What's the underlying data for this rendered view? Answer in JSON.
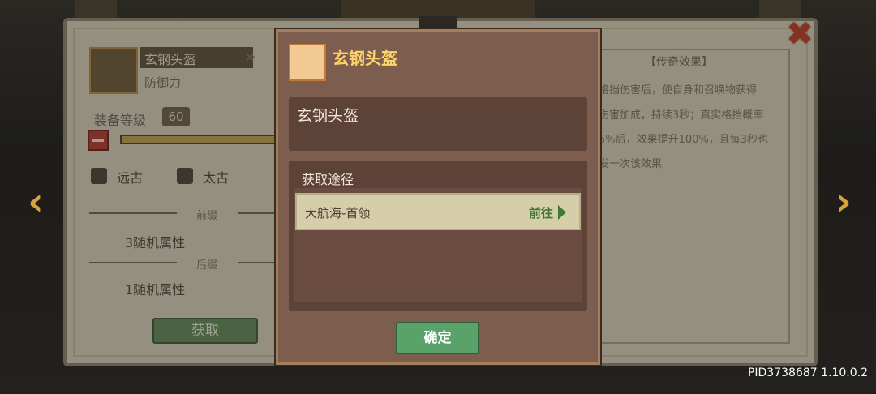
{
  "item": {
    "name": "玄钢头盔",
    "type": "防御力",
    "level_label": "装备等级",
    "level": "60"
  },
  "options": [
    {
      "label": "远古"
    },
    {
      "label": "太古"
    }
  ],
  "prefix": {
    "title": "前缀",
    "text": "3随机属性"
  },
  "suffix": {
    "title": "后缀",
    "text": "1随机属性"
  },
  "get_button": "获取",
  "legend": {
    "title": "【传奇效果】",
    "lines": [
      "格挡伤害后，使自身和召唤物获得",
      "伤害加成，持续3秒；真实格挡概率",
      "5%后，效果提升100%，且每3秒也",
      "发一次该效果"
    ]
  },
  "modal": {
    "title": "玄钢头盔",
    "name": "玄钢头盔",
    "source_label": "获取途径",
    "source": {
      "text": "大航海-首领",
      "go": "前往"
    },
    "confirm": "确定"
  },
  "pid": "PID3738687 1.10.0.2"
}
